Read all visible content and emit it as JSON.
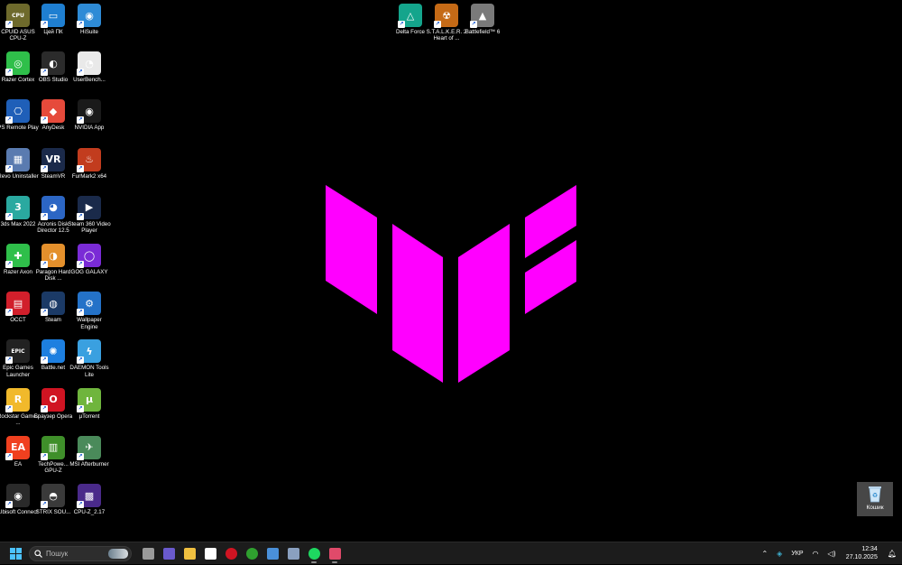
{
  "desktop_icons": [
    {
      "label": "CPUID ASUS CPU-Z",
      "icon": "cpu-z-icon",
      "color": "#6e6a2c",
      "glyph": "CPU"
    },
    {
      "label": "Цей ПК",
      "icon": "this-pc-icon",
      "color": "#1f7fd1",
      "glyph": "▭"
    },
    {
      "label": "HiSuite",
      "icon": "hisuite-icon",
      "color": "#2e8bd6",
      "glyph": "◉"
    },
    {
      "label": "Razer Cortex",
      "icon": "razer-cortex-icon",
      "color": "#2fbf4a",
      "glyph": "◎"
    },
    {
      "label": "OBS Studio",
      "icon": "obs-icon",
      "color": "#2b2b2b",
      "glyph": "◐"
    },
    {
      "label": "UserBench...",
      "icon": "userbenchmark-icon",
      "color": "#e9e9e9",
      "glyph": "◔"
    },
    {
      "label": "PS Remote Play",
      "icon": "ps-remote-play-icon",
      "color": "#1f5fb8",
      "glyph": "⎔"
    },
    {
      "label": "AnyDesk",
      "icon": "anydesk-icon",
      "color": "#e64a3b",
      "glyph": "◆"
    },
    {
      "label": "NVIDIA App",
      "icon": "nvidia-icon",
      "color": "#1a1a1a",
      "glyph": "◉"
    },
    {
      "label": "Revo Uninstaller",
      "icon": "revo-uninstaller-icon",
      "color": "#5a7bb0",
      "glyph": "▦"
    },
    {
      "label": "SteamVR",
      "icon": "steamvr-icon",
      "color": "#1b2a4a",
      "glyph": "VR"
    },
    {
      "label": "FurMark2 x64",
      "icon": "furmark-icon",
      "color": "#c23c1e",
      "glyph": "♨"
    },
    {
      "label": "3ds Max 2022",
      "icon": "3ds-max-icon",
      "color": "#2aa9a0",
      "glyph": "3"
    },
    {
      "label": "Acronis Disk Director 12.5",
      "icon": "acronis-icon",
      "color": "#2c66c4",
      "glyph": "◕"
    },
    {
      "label": "Steam 360 Video Player",
      "icon": "steam-360-icon",
      "color": "#1a2a4a",
      "glyph": "▶"
    },
    {
      "label": "Razer Axon",
      "icon": "razer-axon-icon",
      "color": "#2fbf4a",
      "glyph": "✚"
    },
    {
      "label": "Paragon Hard Disk ...",
      "icon": "paragon-icon",
      "color": "#e4902c",
      "glyph": "◑"
    },
    {
      "label": "GOG GALAXY",
      "icon": "gog-galaxy-icon",
      "color": "#7a2bd6",
      "glyph": "◯"
    },
    {
      "label": "OCCT",
      "icon": "occt-icon",
      "color": "#d11f2b",
      "glyph": "▤"
    },
    {
      "label": "Steam",
      "icon": "steam-icon",
      "color": "#1b3a66",
      "glyph": "◍"
    },
    {
      "label": "Wallpaper Engine",
      "icon": "wallpaper-engine-icon",
      "color": "#2472c8",
      "glyph": "⚙"
    },
    {
      "label": "Epic Games Launcher",
      "icon": "epic-games-icon",
      "color": "#222222",
      "glyph": "EPIC"
    },
    {
      "label": "Battle.net",
      "icon": "battlenet-icon",
      "color": "#1d7fe0",
      "glyph": "✺"
    },
    {
      "label": "DAEMON Tools Lite",
      "icon": "daemon-tools-icon",
      "color": "#3aa0e0",
      "glyph": "ϟ"
    },
    {
      "label": "Rockstar Games ...",
      "icon": "rockstar-icon",
      "color": "#f1b92b",
      "glyph": "R"
    },
    {
      "label": "Браузер Opera",
      "icon": "opera-icon",
      "color": "#d01422",
      "glyph": "O"
    },
    {
      "label": "µTorrent",
      "icon": "utorrent-icon",
      "color": "#6fb53d",
      "glyph": "µ"
    },
    {
      "label": "EA",
      "icon": "ea-icon",
      "color": "#f0401f",
      "glyph": "EA"
    },
    {
      "label": "TechPowe... GPU-Z",
      "icon": "gpu-z-icon",
      "color": "#3f8f2a",
      "glyph": "▥"
    },
    {
      "label": "MSI Afterburner",
      "icon": "msi-afterburner-icon",
      "color": "#4a8a5a",
      "glyph": "✈"
    },
    {
      "label": "Ubisoft Connect",
      "icon": "ubisoft-icon",
      "color": "#2a2a2a",
      "glyph": "◉"
    },
    {
      "label": "STRIX SOU...",
      "icon": "strix-sound-icon",
      "color": "#3a3a3a",
      "glyph": "◓"
    },
    {
      "label": "CPU-Z_2.17",
      "icon": "cpu-z-2-icon",
      "color": "#4a2a8a",
      "glyph": "▩"
    },
    {
      "label": "Delta Force",
      "icon": "delta-force-icon",
      "color": "#14a58c",
      "glyph": "△"
    },
    {
      "label": "S.T.A.L.K.E.R. 2 Heart of ...",
      "icon": "stalker2-icon",
      "color": "#c56a16",
      "glyph": "☢"
    },
    {
      "label": "Battlefield™ 6",
      "icon": "battlefield6-icon",
      "color": "#7a7a7a",
      "glyph": "▲"
    }
  ],
  "recycle_bin": {
    "label": "Кошик"
  },
  "wallpaper": {
    "logo_color": "#ff00ff",
    "background": "#000000"
  },
  "taskbar": {
    "search_placeholder": "Пошук",
    "apps": [
      {
        "name": "task-view-icon",
        "color": "#9a9a9a"
      },
      {
        "name": "copilot-icon",
        "color": "#6a5acd"
      },
      {
        "name": "file-explorer-icon",
        "color": "#f0c040"
      },
      {
        "name": "microsoft-store-icon",
        "color": "#ffffff"
      },
      {
        "name": "opera-taskbar-icon",
        "color": "#d01422"
      },
      {
        "name": "xbox-icon",
        "color": "#2fa02f"
      },
      {
        "name": "remote-desktop-icon",
        "color": "#4a90d9"
      },
      {
        "name": "calculator-icon",
        "color": "#8aa0c0"
      },
      {
        "name": "spotify-icon",
        "color": "#1ed760"
      },
      {
        "name": "snipping-tool-icon",
        "color": "#e04a6a"
      }
    ],
    "language": "УКР",
    "time": "12:34",
    "date": "27.10.2025"
  }
}
